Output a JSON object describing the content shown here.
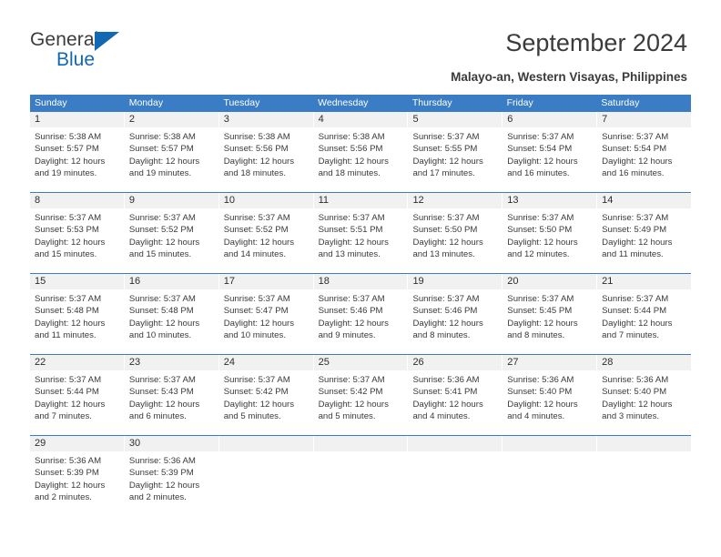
{
  "brand": {
    "name_line1": "General",
    "name_line2": "Blue",
    "accent_color": "#1268b3"
  },
  "header": {
    "title": "September 2024",
    "subtitle": "Malayo-an, Western Visayas, Philippines"
  },
  "theme": {
    "header_blue": "#3b7dc4",
    "day_number_bg": "#f1f1f1",
    "text_color": "#3a3a3a"
  },
  "calendar": {
    "weekdays": [
      "Sunday",
      "Monday",
      "Tuesday",
      "Wednesday",
      "Thursday",
      "Friday",
      "Saturday"
    ],
    "weeks": [
      [
        {
          "day": "1",
          "sunrise": "Sunrise: 5:38 AM",
          "sunset": "Sunset: 5:57 PM",
          "daylight1": "Daylight: 12 hours",
          "daylight2": "and 19 minutes."
        },
        {
          "day": "2",
          "sunrise": "Sunrise: 5:38 AM",
          "sunset": "Sunset: 5:57 PM",
          "daylight1": "Daylight: 12 hours",
          "daylight2": "and 19 minutes."
        },
        {
          "day": "3",
          "sunrise": "Sunrise: 5:38 AM",
          "sunset": "Sunset: 5:56 PM",
          "daylight1": "Daylight: 12 hours",
          "daylight2": "and 18 minutes."
        },
        {
          "day": "4",
          "sunrise": "Sunrise: 5:38 AM",
          "sunset": "Sunset: 5:56 PM",
          "daylight1": "Daylight: 12 hours",
          "daylight2": "and 18 minutes."
        },
        {
          "day": "5",
          "sunrise": "Sunrise: 5:37 AM",
          "sunset": "Sunset: 5:55 PM",
          "daylight1": "Daylight: 12 hours",
          "daylight2": "and 17 minutes."
        },
        {
          "day": "6",
          "sunrise": "Sunrise: 5:37 AM",
          "sunset": "Sunset: 5:54 PM",
          "daylight1": "Daylight: 12 hours",
          "daylight2": "and 16 minutes."
        },
        {
          "day": "7",
          "sunrise": "Sunrise: 5:37 AM",
          "sunset": "Sunset: 5:54 PM",
          "daylight1": "Daylight: 12 hours",
          "daylight2": "and 16 minutes."
        }
      ],
      [
        {
          "day": "8",
          "sunrise": "Sunrise: 5:37 AM",
          "sunset": "Sunset: 5:53 PM",
          "daylight1": "Daylight: 12 hours",
          "daylight2": "and 15 minutes."
        },
        {
          "day": "9",
          "sunrise": "Sunrise: 5:37 AM",
          "sunset": "Sunset: 5:52 PM",
          "daylight1": "Daylight: 12 hours",
          "daylight2": "and 15 minutes."
        },
        {
          "day": "10",
          "sunrise": "Sunrise: 5:37 AM",
          "sunset": "Sunset: 5:52 PM",
          "daylight1": "Daylight: 12 hours",
          "daylight2": "and 14 minutes."
        },
        {
          "day": "11",
          "sunrise": "Sunrise: 5:37 AM",
          "sunset": "Sunset: 5:51 PM",
          "daylight1": "Daylight: 12 hours",
          "daylight2": "and 13 minutes."
        },
        {
          "day": "12",
          "sunrise": "Sunrise: 5:37 AM",
          "sunset": "Sunset: 5:50 PM",
          "daylight1": "Daylight: 12 hours",
          "daylight2": "and 13 minutes."
        },
        {
          "day": "13",
          "sunrise": "Sunrise: 5:37 AM",
          "sunset": "Sunset: 5:50 PM",
          "daylight1": "Daylight: 12 hours",
          "daylight2": "and 12 minutes."
        },
        {
          "day": "14",
          "sunrise": "Sunrise: 5:37 AM",
          "sunset": "Sunset: 5:49 PM",
          "daylight1": "Daylight: 12 hours",
          "daylight2": "and 11 minutes."
        }
      ],
      [
        {
          "day": "15",
          "sunrise": "Sunrise: 5:37 AM",
          "sunset": "Sunset: 5:48 PM",
          "daylight1": "Daylight: 12 hours",
          "daylight2": "and 11 minutes."
        },
        {
          "day": "16",
          "sunrise": "Sunrise: 5:37 AM",
          "sunset": "Sunset: 5:48 PM",
          "daylight1": "Daylight: 12 hours",
          "daylight2": "and 10 minutes."
        },
        {
          "day": "17",
          "sunrise": "Sunrise: 5:37 AM",
          "sunset": "Sunset: 5:47 PM",
          "daylight1": "Daylight: 12 hours",
          "daylight2": "and 10 minutes."
        },
        {
          "day": "18",
          "sunrise": "Sunrise: 5:37 AM",
          "sunset": "Sunset: 5:46 PM",
          "daylight1": "Daylight: 12 hours",
          "daylight2": "and 9 minutes."
        },
        {
          "day": "19",
          "sunrise": "Sunrise: 5:37 AM",
          "sunset": "Sunset: 5:46 PM",
          "daylight1": "Daylight: 12 hours",
          "daylight2": "and 8 minutes."
        },
        {
          "day": "20",
          "sunrise": "Sunrise: 5:37 AM",
          "sunset": "Sunset: 5:45 PM",
          "daylight1": "Daylight: 12 hours",
          "daylight2": "and 8 minutes."
        },
        {
          "day": "21",
          "sunrise": "Sunrise: 5:37 AM",
          "sunset": "Sunset: 5:44 PM",
          "daylight1": "Daylight: 12 hours",
          "daylight2": "and 7 minutes."
        }
      ],
      [
        {
          "day": "22",
          "sunrise": "Sunrise: 5:37 AM",
          "sunset": "Sunset: 5:44 PM",
          "daylight1": "Daylight: 12 hours",
          "daylight2": "and 7 minutes."
        },
        {
          "day": "23",
          "sunrise": "Sunrise: 5:37 AM",
          "sunset": "Sunset: 5:43 PM",
          "daylight1": "Daylight: 12 hours",
          "daylight2": "and 6 minutes."
        },
        {
          "day": "24",
          "sunrise": "Sunrise: 5:37 AM",
          "sunset": "Sunset: 5:42 PM",
          "daylight1": "Daylight: 12 hours",
          "daylight2": "and 5 minutes."
        },
        {
          "day": "25",
          "sunrise": "Sunrise: 5:37 AM",
          "sunset": "Sunset: 5:42 PM",
          "daylight1": "Daylight: 12 hours",
          "daylight2": "and 5 minutes."
        },
        {
          "day": "26",
          "sunrise": "Sunrise: 5:36 AM",
          "sunset": "Sunset: 5:41 PM",
          "daylight1": "Daylight: 12 hours",
          "daylight2": "and 4 minutes."
        },
        {
          "day": "27",
          "sunrise": "Sunrise: 5:36 AM",
          "sunset": "Sunset: 5:40 PM",
          "daylight1": "Daylight: 12 hours",
          "daylight2": "and 4 minutes."
        },
        {
          "day": "28",
          "sunrise": "Sunrise: 5:36 AM",
          "sunset": "Sunset: 5:40 PM",
          "daylight1": "Daylight: 12 hours",
          "daylight2": "and 3 minutes."
        }
      ],
      [
        {
          "day": "29",
          "sunrise": "Sunrise: 5:36 AM",
          "sunset": "Sunset: 5:39 PM",
          "daylight1": "Daylight: 12 hours",
          "daylight2": "and 2 minutes."
        },
        {
          "day": "30",
          "sunrise": "Sunrise: 5:36 AM",
          "sunset": "Sunset: 5:39 PM",
          "daylight1": "Daylight: 12 hours",
          "daylight2": "and 2 minutes."
        },
        {
          "day": "",
          "sunrise": "",
          "sunset": "",
          "daylight1": "",
          "daylight2": ""
        },
        {
          "day": "",
          "sunrise": "",
          "sunset": "",
          "daylight1": "",
          "daylight2": ""
        },
        {
          "day": "",
          "sunrise": "",
          "sunset": "",
          "daylight1": "",
          "daylight2": ""
        },
        {
          "day": "",
          "sunrise": "",
          "sunset": "",
          "daylight1": "",
          "daylight2": ""
        },
        {
          "day": "",
          "sunrise": "",
          "sunset": "",
          "daylight1": "",
          "daylight2": ""
        }
      ]
    ]
  }
}
